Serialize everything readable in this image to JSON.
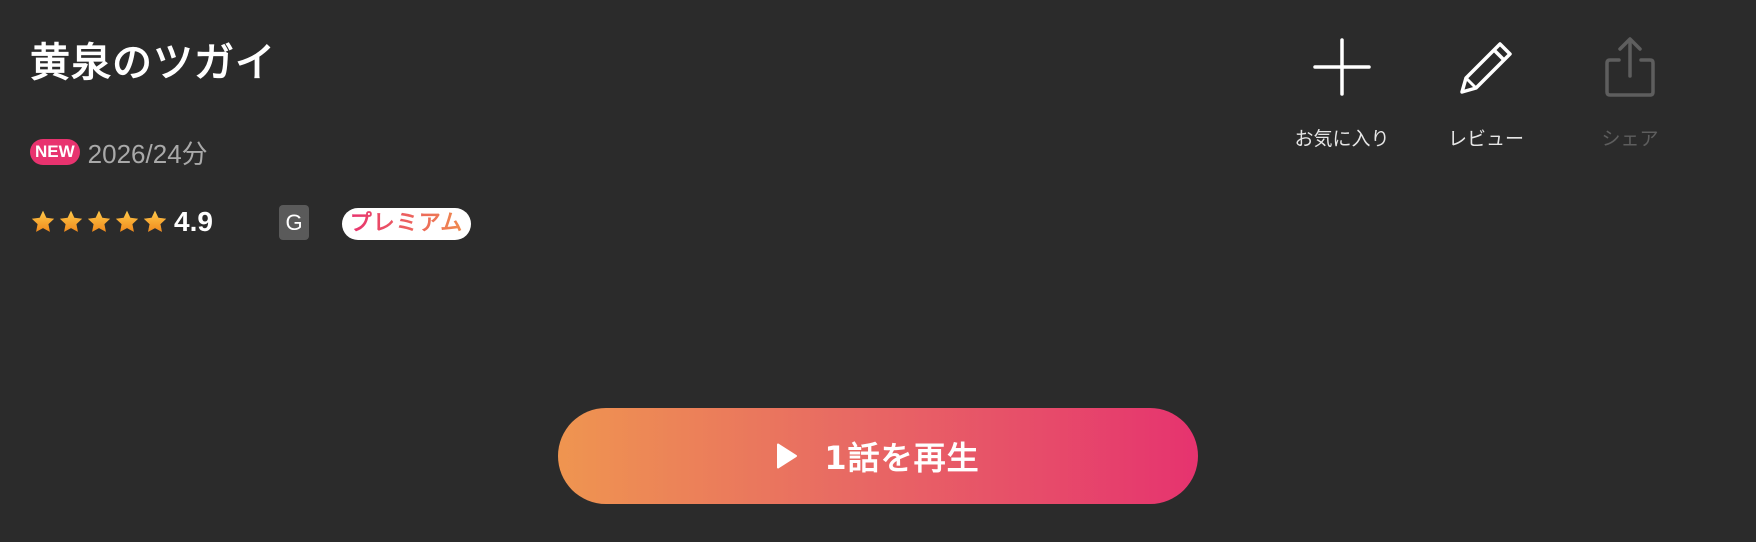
{
  "title": "黄泉のツガイ",
  "meta": {
    "new_badge": "NEW",
    "year_duration": "2026/24分"
  },
  "rating": {
    "value": "4.9",
    "stars_filled_fraction": 0.98,
    "star_color": "#f5a623"
  },
  "age_rating": "G",
  "premium_badge": "プレミアム",
  "actions": [
    {
      "label": "お気に入り",
      "icon": "plus-icon",
      "enabled": true
    },
    {
      "label": "レビュー",
      "icon": "pencil-icon",
      "enabled": true
    },
    {
      "label": "シェア",
      "icon": "share-icon",
      "enabled": false
    }
  ],
  "play_button": {
    "label": "1話を再生",
    "icon": "play-icon"
  },
  "colors": {
    "background": "#2b2b2b",
    "accent_pink": "#e6336f",
    "accent_orange": "#ef9550",
    "muted_text": "#a9a9a9",
    "disabled": "#5e5e5e"
  }
}
